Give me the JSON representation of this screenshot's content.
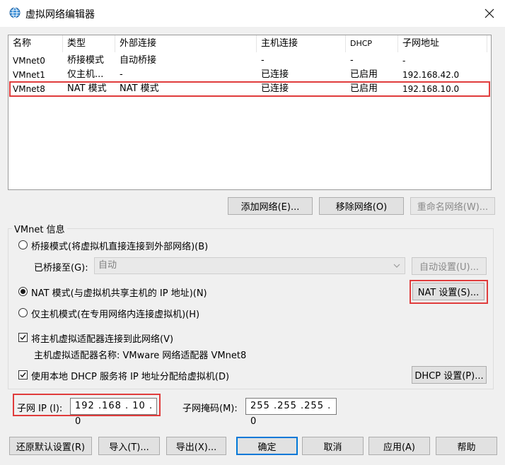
{
  "window": {
    "title": "虚拟网络编辑器",
    "icon": "globe-icon",
    "close_icon": "close-icon"
  },
  "table": {
    "columns": [
      "名称",
      "类型",
      "外部连接",
      "主机连接",
      "DHCP",
      "子网地址"
    ],
    "rows": [
      {
        "name": "VMnet0",
        "type": "桥接模式",
        "external": "自动桥接",
        "host": "-",
        "dhcp": "-",
        "subnet": "-"
      },
      {
        "name": "VMnet1",
        "type": "仅主机...",
        "external": "-",
        "host": "已连接",
        "dhcp": "已启用",
        "subnet": "192.168.42.0"
      },
      {
        "name": "VMnet8",
        "type": "NAT 模式",
        "external": "NAT 模式",
        "host": "已连接",
        "dhcp": "已启用",
        "subnet": "192.168.10.0"
      }
    ],
    "highlighted_row": "VMnet8"
  },
  "network_buttons": {
    "add": "添加网络(E)...",
    "remove": "移除网络(O)",
    "rename": "重命名网络(W)..."
  },
  "vmnet_info": {
    "title": "VMnet 信息",
    "bridged_label": "桥接模式(将虚拟机直接连接到外部网络)(B)",
    "bridged_to_label": "已桥接至(G):",
    "bridged_to_value": "自动",
    "auto_settings": "自动设置(U)...",
    "nat_label": "NAT 模式(与虚拟机共享主机的 IP 地址)(N)",
    "nat_settings": "NAT 设置(S)...",
    "hostonly_label": "仅主机模式(在专用网络内连接虚拟机)(H)",
    "selected_mode": "nat",
    "connect_adapter_label": "将主机虚拟适配器连接到此网络(V)",
    "connect_adapter_checked": true,
    "adapter_name_label": "主机虚拟适配器名称: VMware 网络适配器 VMnet8",
    "dhcp_label": "使用本地 DHCP 服务将 IP 地址分配给虚拟机(D)",
    "dhcp_checked": true,
    "dhcp_settings": "DHCP 设置(P)...",
    "subnet_ip_label": "子网 IP (I):",
    "subnet_ip_value": "192 .168 . 10 . 0",
    "subnet_mask_label": "子网掩码(M):",
    "subnet_mask_value": "255 .255 .255 . 0"
  },
  "footer_buttons": {
    "restore": "还原默认设置(R)",
    "import": "导入(T)...",
    "export": "导出(X)...",
    "ok": "确定",
    "cancel": "取消",
    "apply": "应用(A)",
    "help": "帮助"
  },
  "accent": {
    "highlight_red": "#e03c3c",
    "focus_blue": "#0078d7"
  }
}
